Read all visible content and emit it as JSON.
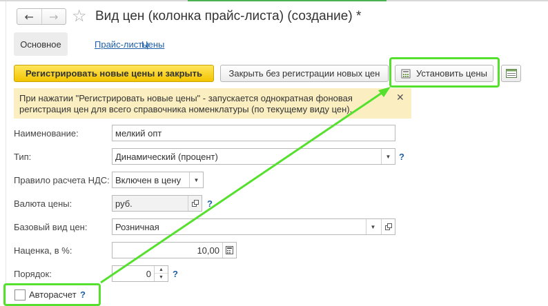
{
  "window": {
    "title": "Вид цен (колонка прайс-листа) (создание) *",
    "back_icon": "←",
    "forward_icon": "→",
    "favorite_icon": "☆"
  },
  "tabs": [
    {
      "label": "Основное",
      "active": true
    },
    {
      "label": "Прайс-листы",
      "active": false
    },
    {
      "label": "Цены",
      "active": false
    }
  ],
  "toolbar": {
    "primary_label": "Регистрировать новые цены и закрыть",
    "close_label": "Закрыть без регистрации новых цен",
    "set_prices_label": "Установить цены"
  },
  "info": {
    "text": "При нажатии \"Регистрировать новые цены\" - запускается однократная фоновая регистрация цен для всего справочника номенклатуры (по текущему виду цен).",
    "close_icon": "✕"
  },
  "form": {
    "name_label": "Наименование:",
    "name_value": "мелкий опт",
    "type_label": "Тип:",
    "type_value": "Динамический (процент)",
    "vat_label": "Правило расчета НДС:",
    "vat_value": "Включен в цену",
    "currency_label": "Валюта цены:",
    "currency_value": "руб.",
    "base_label": "Базовый вид цен:",
    "base_value": "Розничная",
    "markup_label": "Наценка, в %:",
    "markup_value": "10,00",
    "order_label": "Порядок:",
    "order_value": "0",
    "auto_label": "Авторасчет",
    "auto_checked": false,
    "help": "?"
  },
  "colors": {
    "accent_yellow": "#f3c400",
    "link": "#1e5fa8",
    "info_bg": "#fbefc2",
    "annotation_green": "#55e02e"
  }
}
